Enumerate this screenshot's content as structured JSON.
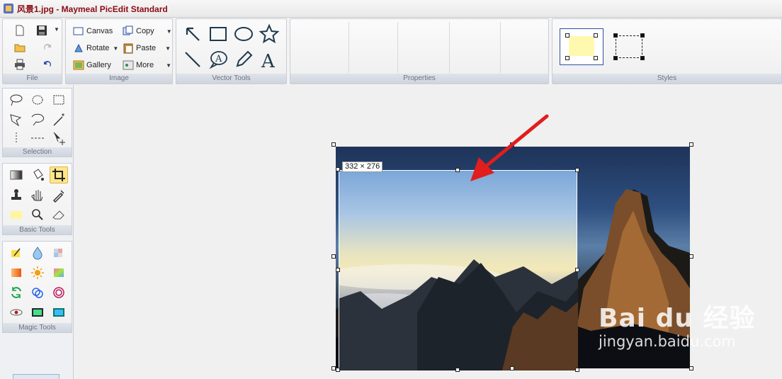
{
  "window": {
    "title": "风景1.jpg - Maymeal PicEdit Standard"
  },
  "ribbon": {
    "groups": {
      "file": {
        "label": "File"
      },
      "image": {
        "label": "Image",
        "canvas": "Canvas",
        "rotate": "Rotate",
        "gallery": "Gallery",
        "copy": "Copy",
        "paste": "Paste",
        "more": "More"
      },
      "vector": {
        "label": "Vector Tools"
      },
      "properties": {
        "label": "Properties"
      },
      "styles": {
        "label": "Styles"
      }
    }
  },
  "panels": {
    "selection": {
      "label": "Selection"
    },
    "basic": {
      "label": "Basic Tools",
      "active_tool": "crop-icon"
    },
    "magic": {
      "label": "Magic Tools"
    }
  },
  "canvas": {
    "selection_size": "332 × 276",
    "watermark": {
      "brand": "Bai du 经验",
      "url": "jingyan.baidu.com"
    }
  },
  "colors": {
    "accent": "#8b0a14",
    "active_tool": "#fde68a",
    "arrow": "#e11d1d",
    "style_fill": "#fff9b0"
  }
}
